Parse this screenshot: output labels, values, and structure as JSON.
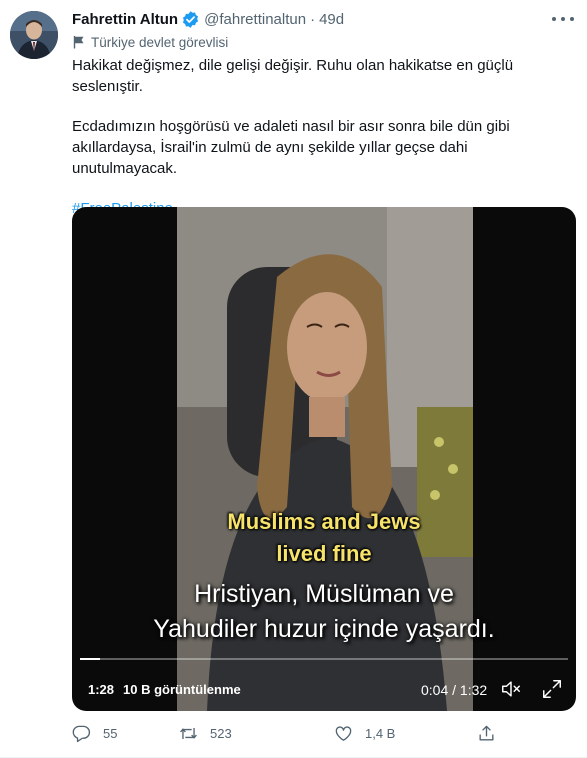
{
  "tweet": {
    "author_name": "Fahrettin Altun",
    "handle": "@fahrettinaltun",
    "separator": "·",
    "age": "49d",
    "account_label": "Türkiye devlet görevlisi",
    "paragraph1": "Hakikat değişmez, dile gelişi değişir. Ruhu olan hakikatse en güçlü seslenıştir.",
    "paragraph2": "Ecdadımızın hoşgörüsü ve adaleti nasıl bir asır sonra bile dün gibi akıllardaysa, İsrail'in zulmü de aynı şekilde yıllar geçse dahi unutulmayacak.",
    "hashtag": "#FreePalestine"
  },
  "video": {
    "caption_line1": "Muslims and Jews",
    "caption_line2": "lived fine",
    "subtitle_line1": "Hristiyan, Müslüman ve",
    "subtitle_line2": "Yahudiler huzur içinde yaşardı.",
    "duration_badge": "1:28",
    "views": "10 B görüntülenme",
    "time_readout": "0:04 / 1:32",
    "progress_fraction": 0.04
  },
  "actions": {
    "reply_count": "55",
    "retweet_count": "523",
    "like_count": "1,4 B"
  },
  "colors": {
    "accent": "#1d9bf0",
    "secondary_text": "#536471",
    "caption_yellow": "#f7e36a"
  },
  "icons": [
    "verified-badge-icon",
    "flag-icon",
    "more-icon",
    "volume-mute-icon",
    "fullscreen-icon",
    "reply-icon",
    "retweet-icon",
    "like-icon",
    "share-icon"
  ]
}
